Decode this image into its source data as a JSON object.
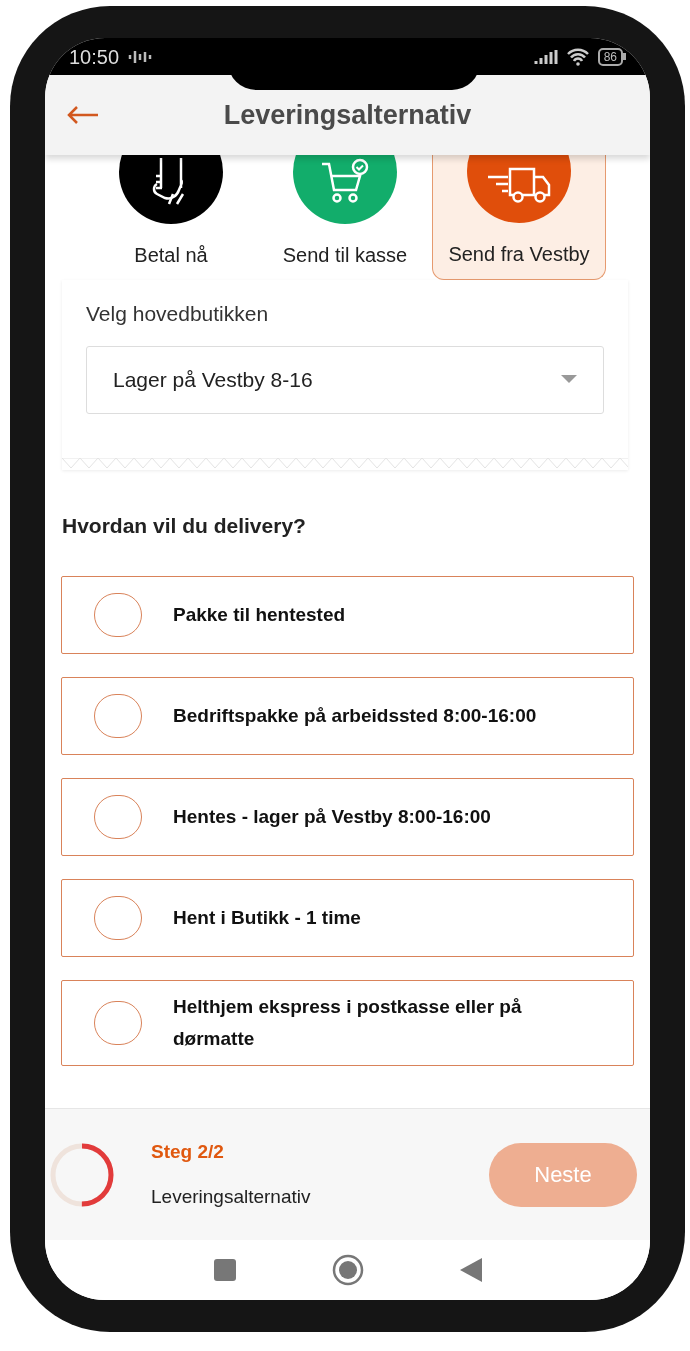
{
  "status_bar": {
    "time": "10:50",
    "battery": "86"
  },
  "header": {
    "title": "Leveringsalternativ"
  },
  "methods": [
    {
      "kind": "pay",
      "label": "Betal nå",
      "color": "#000000",
      "selected": false
    },
    {
      "kind": "cart",
      "label": "Send til kasse",
      "color": "#12ad6b",
      "selected": false
    },
    {
      "kind": "truck",
      "label": "Send fra Vestby",
      "color": "#e04e0b",
      "selected": true
    }
  ],
  "store_select": {
    "label": "Velg hovedbutikken",
    "value": "Lager på Vestby 8-16"
  },
  "delivery": {
    "question": "Hvordan vil du delivery?",
    "options": [
      {
        "label": "Pakke til hentested",
        "selected": false
      },
      {
        "label": "Bedriftspakke på arbeidssted 8:00-16:00",
        "selected": false
      },
      {
        "label": "Hentes - lager på Vestby 8:00-16:00",
        "selected": false
      },
      {
        "label": "Hent i Butikk - 1 time",
        "selected": false
      },
      {
        "label": "Helthjem ekspress i postkasse eller på dørmatte",
        "selected": false
      }
    ]
  },
  "footer": {
    "step": "Steg 2/2",
    "step_name": "Leveringsalternativ",
    "level": 0.5,
    "next_button": {
      "label": "Neste",
      "disabled": true
    }
  }
}
